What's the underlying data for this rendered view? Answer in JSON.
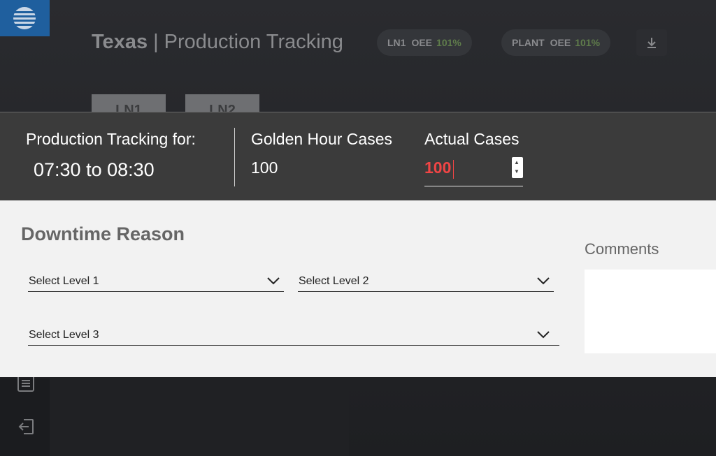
{
  "header": {
    "location": "Texas",
    "separator": "|",
    "title": "Production Tracking"
  },
  "pills": [
    {
      "line": "LN1",
      "metric": "OEE",
      "value": "101%"
    },
    {
      "line": "PLANT",
      "metric": "OEE",
      "value": "101%"
    }
  ],
  "line_tabs": [
    "LN1",
    "LN2"
  ],
  "icons": {
    "logo": "globe-logo-icon",
    "download": "download-icon",
    "list": "list-icon",
    "logout": "logout-icon",
    "dropdown": "chevron-down-icon"
  },
  "tracking": {
    "label": "Production Tracking for:",
    "time_range": "07:30 to 08:30",
    "golden_label": "Golden Hour Cases",
    "golden_value": "100",
    "actual_label": "Actual Cases",
    "actual_value": "100"
  },
  "downtime": {
    "title": "Downtime Reason",
    "level1_placeholder": "Select Level 1",
    "level2_placeholder": "Select Level 2",
    "level3_placeholder": "Select Level 3"
  },
  "comments": {
    "label": "Comments",
    "value": ""
  },
  "colors": {
    "brand_blue": "#1f5f9e",
    "band_background": "#3b3b3b",
    "actual_value_red": "#f04545",
    "oee_green": "#5f7c4b"
  }
}
